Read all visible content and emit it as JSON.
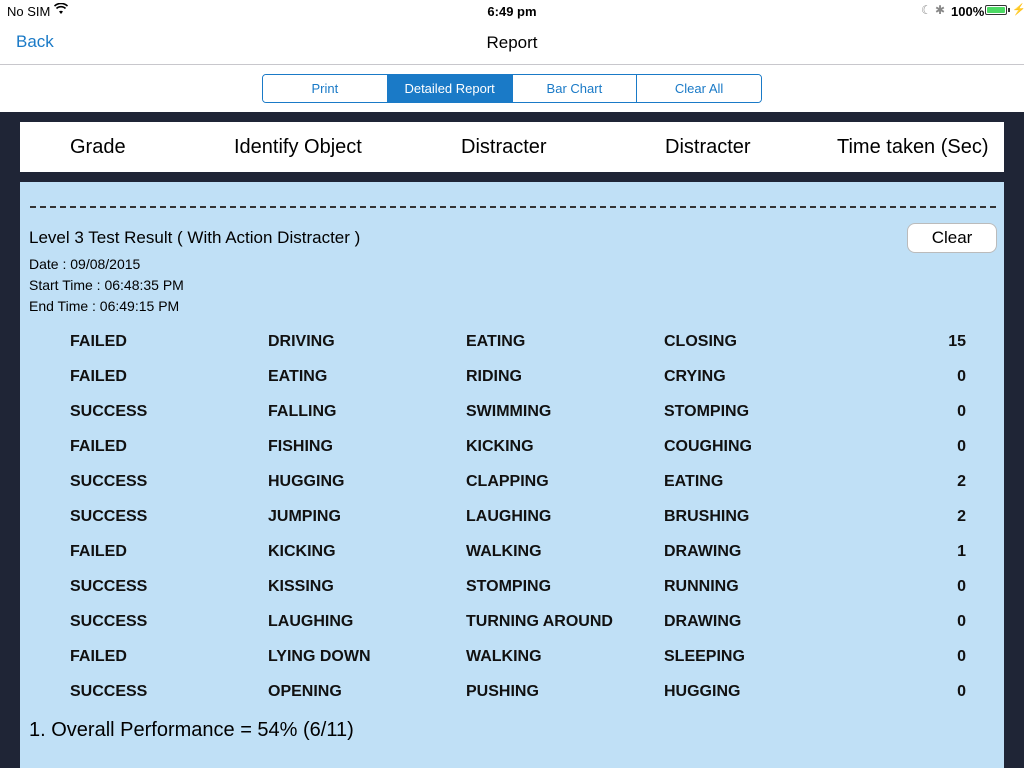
{
  "status_bar": {
    "carrier": "No SIM",
    "time": "6:49 pm",
    "battery": "100%",
    "battery_level": 1.0,
    "battery_color": "#4cd964"
  },
  "nav": {
    "back_label": "Back",
    "title": "Report"
  },
  "segments": [
    {
      "label": "Print",
      "active": false
    },
    {
      "label": "Detailed Report",
      "active": true
    },
    {
      "label": "Bar Chart",
      "active": false
    },
    {
      "label": "Clear All",
      "active": false
    }
  ],
  "table_header": [
    "Grade",
    "Identify Object",
    "Distracter",
    "Distracter",
    "Time taken (Sec)"
  ],
  "report": {
    "title": "Level 3 Test Result ( With Action Distracter )",
    "clear_label": "Clear",
    "date": "Date : 09/08/2015",
    "start_time": "Start Time : 06:48:35 PM",
    "end_time": "End Time : 06:49:15 PM",
    "rows": [
      [
        "FAILED",
        "DRIVING",
        "EATING",
        "CLOSING",
        "15"
      ],
      [
        "FAILED",
        "EATING",
        "RIDING",
        "CRYING",
        "0"
      ],
      [
        "SUCCESS",
        "FALLING",
        "SWIMMING",
        "STOMPING",
        "0"
      ],
      [
        "FAILED",
        "FISHING",
        "KICKING",
        "COUGHING",
        "0"
      ],
      [
        "SUCCESS",
        "HUGGING",
        "CLAPPING",
        "EATING",
        "2"
      ],
      [
        "SUCCESS",
        "JUMPING",
        "LAUGHING",
        "BRUSHING",
        "2"
      ],
      [
        "FAILED",
        "KICKING",
        "WALKING",
        "DRAWING",
        "1"
      ],
      [
        "SUCCESS",
        "KISSING",
        "STOMPING",
        "RUNNING",
        "0"
      ],
      [
        "SUCCESS",
        "LAUGHING",
        "TURNING AROUND",
        "DRAWING",
        "0"
      ],
      [
        "FAILED",
        "LYING DOWN",
        "WALKING",
        "SLEEPING",
        "0"
      ],
      [
        "SUCCESS",
        "OPENING",
        "PUSHING",
        "HUGGING",
        "0"
      ]
    ],
    "overall": "1. Overall Performance = 54% (6/11)"
  },
  "colors": {
    "accent": "#1a7ac7",
    "frame": "#1f2536",
    "content_bg": "#c0e0f6"
  }
}
